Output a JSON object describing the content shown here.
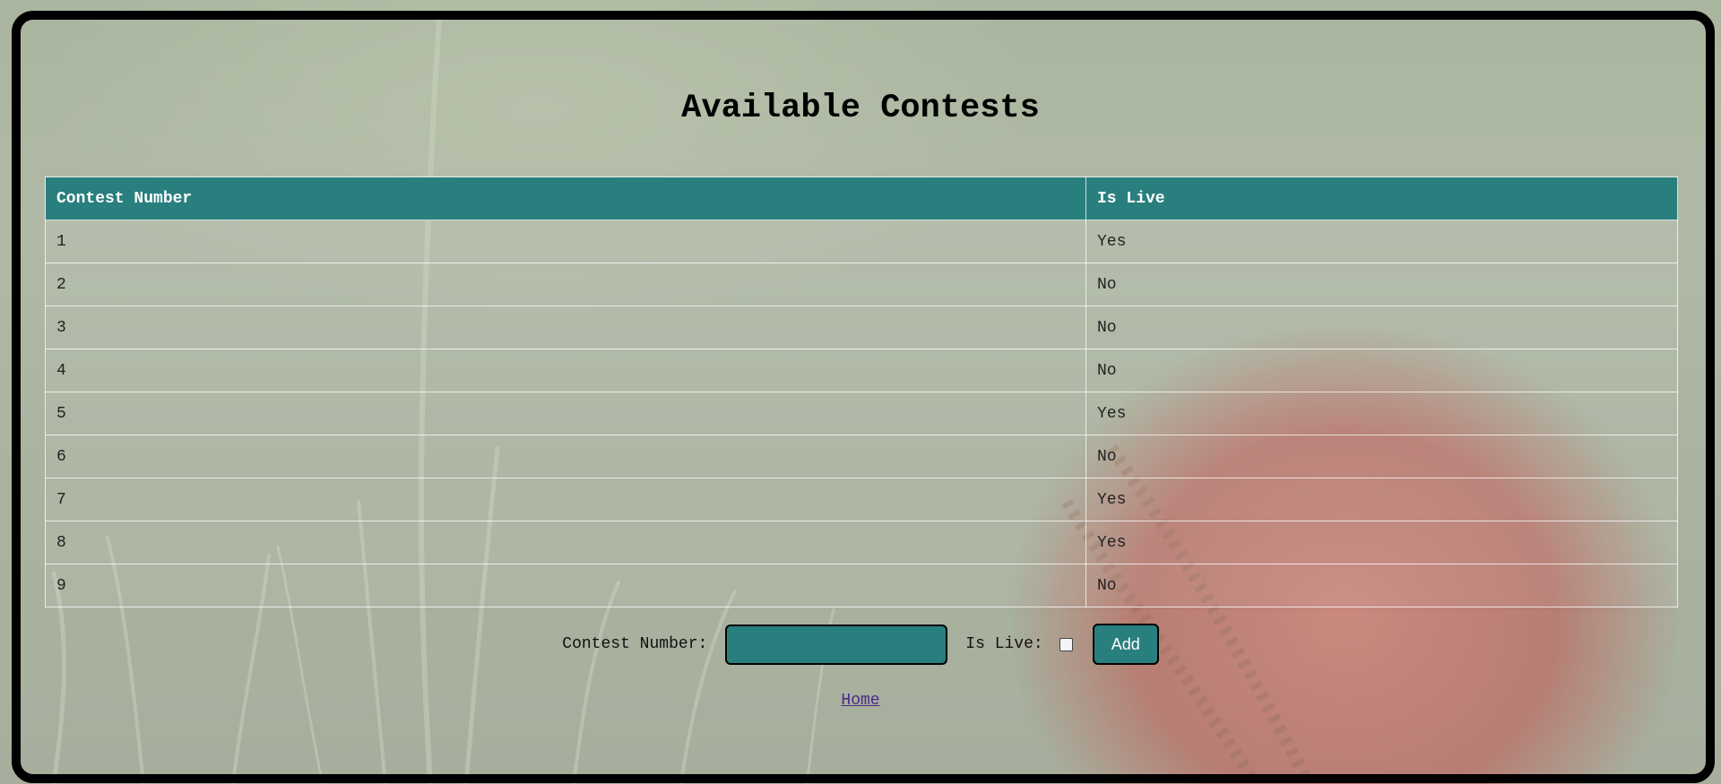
{
  "page": {
    "title": "Available Contests"
  },
  "table": {
    "headers": [
      "Contest Number",
      "Is Live"
    ],
    "rows": [
      [
        "1",
        "Yes"
      ],
      [
        "2",
        "No"
      ],
      [
        "3",
        "No"
      ],
      [
        "4",
        "No"
      ],
      [
        "5",
        "Yes"
      ],
      [
        "6",
        "No"
      ],
      [
        "7",
        "Yes"
      ],
      [
        "8",
        "Yes"
      ],
      [
        "9",
        "No"
      ]
    ]
  },
  "form": {
    "contest_number_label": "Contest Number:",
    "contest_number_value": "",
    "is_live_label": "Is Live:",
    "is_live_checked": false,
    "add_label": "Add"
  },
  "nav": {
    "home_label": "Home"
  },
  "colors": {
    "accent": "#297f7e",
    "frame": "#000000",
    "link": "#4b2a8a"
  }
}
